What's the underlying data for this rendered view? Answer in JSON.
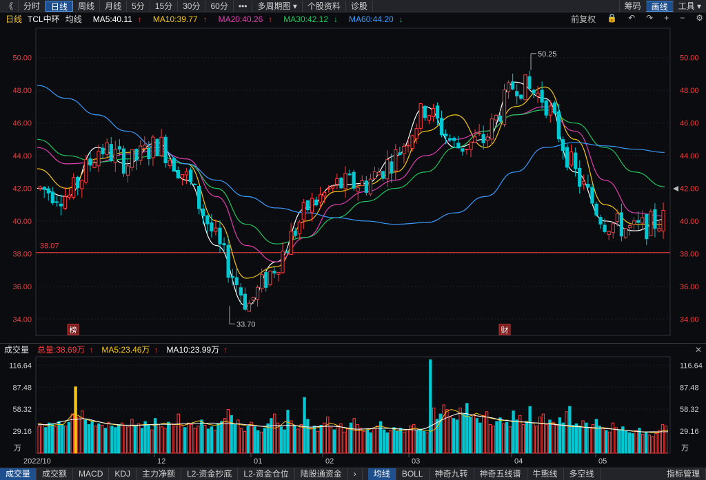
{
  "toolbar": {
    "back": "《",
    "periods": [
      "分时",
      "日线",
      "周线",
      "月线",
      "5分",
      "15分",
      "30分",
      "60分"
    ],
    "active_period": "日线",
    "more": "•••",
    "multi_period": "多周期图",
    "stock_info": "个股资料",
    "diagnose": "诊股",
    "chips": "筹码",
    "draw": "画线",
    "tools": "工具"
  },
  "info": {
    "period": "日线",
    "stock": "TCL中环",
    "avg_line": "均线",
    "ma5": "MA5:40.11",
    "ma10": "MA10:39.77",
    "ma20": "MA20:40.26",
    "ma30": "MA30:42.12",
    "ma60": "MA60:44.20",
    "adjust": "前复权"
  },
  "colors": {
    "up": "#ff3b3b",
    "down": "#00c8d2",
    "ma5": "#ffffff",
    "ma10": "#f5c518",
    "ma20": "#e040b0",
    "ma30": "#22c55e",
    "ma60": "#3b9cff",
    "axis_text": "#e84040"
  },
  "chart_data": [
    {
      "type": "candlestick",
      "yticks": [
        "50.00",
        "48.00",
        "46.00",
        "44.00",
        "42.00",
        "40.00",
        "38.00",
        "36.00",
        "34.00"
      ],
      "ylim": [
        33.0,
        51.8
      ],
      "h_line_value": 38.07,
      "h_line_label": "38.07",
      "max_label": "50.25",
      "min_label": "33.70",
      "markers": [
        "榜",
        "财"
      ],
      "ma_names": [
        "MA5",
        "MA10",
        "MA20",
        "MA30",
        "MA60"
      ],
      "ma_anchor_values": {
        "MA5": [
          42.0,
          41.5,
          44.5,
          43.5,
          44.8,
          42.5,
          38.5,
          34.8,
          37.5,
          40.8,
          42.2,
          42.3,
          44.0,
          47.0,
          44.5,
          45.0,
          48.5,
          47.5,
          43.0,
          40.0,
          39.4,
          40.1
        ],
        "MA10": [
          43.2,
          42.0,
          43.8,
          44.2,
          44.5,
          43.5,
          40.0,
          36.5,
          37.2,
          40.0,
          41.8,
          42.2,
          43.0,
          45.5,
          46.5,
          44.5,
          47.0,
          48.2,
          45.0,
          41.0,
          39.8,
          39.8
        ],
        "MA20": [
          44.5,
          43.5,
          43.6,
          44.1,
          44.3,
          43.8,
          41.5,
          38.5,
          37.5,
          39.0,
          41.0,
          41.8,
          42.5,
          44.0,
          45.0,
          45.5,
          46.5,
          47.0,
          45.5,
          42.5,
          40.5,
          40.3
        ],
        "MA30": [
          45.0,
          44.0,
          43.6,
          43.8,
          44.0,
          43.5,
          42.0,
          39.8,
          38.6,
          39.0,
          40.2,
          41.2,
          42.0,
          43.0,
          44.5,
          45.5,
          46.5,
          46.8,
          46.0,
          44.5,
          43.0,
          42.1
        ],
        "MA60": [
          48.3,
          47.5,
          46.5,
          45.5,
          44.5,
          43.5,
          42.5,
          41.5,
          40.8,
          40.5,
          40.2,
          40.0,
          39.8,
          39.9,
          40.5,
          41.5,
          43.0,
          44.5,
          44.8,
          44.6,
          44.4,
          44.2
        ]
      }
    },
    {
      "type": "bar",
      "title": "成交量",
      "total": "总量:38.69万",
      "ma5": "MA5:23.46万",
      "ma10": "MA10:23.99万",
      "yticks": [
        "116.64",
        "87.48",
        "58.32",
        "29.16"
      ],
      "unit": "万",
      "ylim": [
        0,
        128
      ],
      "xticks": [
        "2022/10",
        "12",
        "01",
        "02",
        "03",
        "04",
        "05"
      ],
      "volumes": [
        36,
        38,
        34,
        40,
        39,
        35,
        42,
        38,
        36,
        41,
        52,
        88,
        48,
        56,
        44,
        38,
        42,
        36,
        39,
        37,
        33,
        41,
        36,
        34,
        38,
        40,
        37,
        35,
        45,
        36,
        39,
        33,
        42,
        37,
        31,
        46,
        38,
        35,
        33,
        41,
        39,
        36,
        52,
        37,
        34,
        40,
        38,
        33,
        36,
        44,
        37,
        32,
        35,
        30,
        39,
        42,
        46,
        58,
        50,
        38,
        44,
        33,
        29,
        36,
        41,
        35,
        30,
        28,
        33,
        39,
        46,
        52,
        40,
        35,
        31,
        57,
        43,
        36,
        32,
        38,
        74,
        45,
        33,
        36,
        29,
        37,
        40,
        48,
        34,
        31,
        36,
        39,
        28,
        32,
        40,
        46,
        38,
        33,
        29,
        31,
        27,
        33,
        36,
        42,
        31,
        27,
        30,
        34,
        29,
        33,
        28,
        31,
        36,
        38,
        30,
        32,
        29,
        27,
        124,
        60,
        45,
        52,
        64,
        58,
        48,
        46,
        44,
        60,
        52,
        66,
        48,
        51,
        46,
        40,
        50,
        55,
        38,
        36,
        42,
        47,
        39,
        41,
        35,
        56,
        44,
        50,
        38,
        42,
        62,
        40,
        36,
        48,
        52,
        38,
        44,
        41,
        37,
        47,
        40,
        55,
        62,
        37,
        39,
        36,
        43,
        40,
        34,
        38,
        45,
        36,
        33,
        30,
        28,
        40,
        34,
        31,
        35,
        29,
        27,
        26,
        30,
        33,
        25,
        28,
        24,
        22,
        26,
        30,
        38,
        36
      ],
      "avg": [
        40,
        38,
        36,
        37,
        38,
        38,
        45,
        52,
        50,
        46,
        44,
        42,
        42,
        40,
        39,
        38,
        37,
        37,
        37,
        36,
        37,
        38,
        38,
        37,
        38,
        40,
        39,
        38,
        38,
        37,
        39,
        41,
        43,
        40,
        38,
        37,
        38,
        42,
        41,
        39,
        38,
        37,
        38,
        37,
        36,
        35,
        34,
        33,
        36,
        42,
        40,
        37,
        35,
        34,
        32,
        33,
        35,
        36,
        40,
        38,
        35,
        33,
        32,
        30,
        30,
        31,
        32,
        35,
        36,
        34,
        33,
        31,
        30,
        31,
        32,
        33,
        31,
        30,
        29,
        33,
        44,
        55,
        58,
        56,
        52,
        48,
        50,
        53,
        50,
        48,
        46,
        45,
        43,
        44,
        42,
        42,
        41,
        42,
        40,
        40,
        39,
        39,
        40,
        38,
        37,
        36,
        35,
        36,
        35,
        34,
        33,
        33,
        34,
        33,
        32,
        31,
        31,
        30,
        29,
        29,
        28,
        28,
        27,
        27,
        30,
        30
      ]
    }
  ],
  "bottombar": {
    "indicators": [
      "成交量",
      "成交额",
      "MACD",
      "KDJ",
      "主力净额",
      "L2-资金抄底",
      "L2-资金仓位",
      "陆股通资金"
    ],
    "next": "›",
    "overlays": [
      "均线",
      "BOLL",
      "神奇九转",
      "神奇五线谱",
      "牛熊线",
      "多空线"
    ],
    "settings": "指标管理"
  }
}
